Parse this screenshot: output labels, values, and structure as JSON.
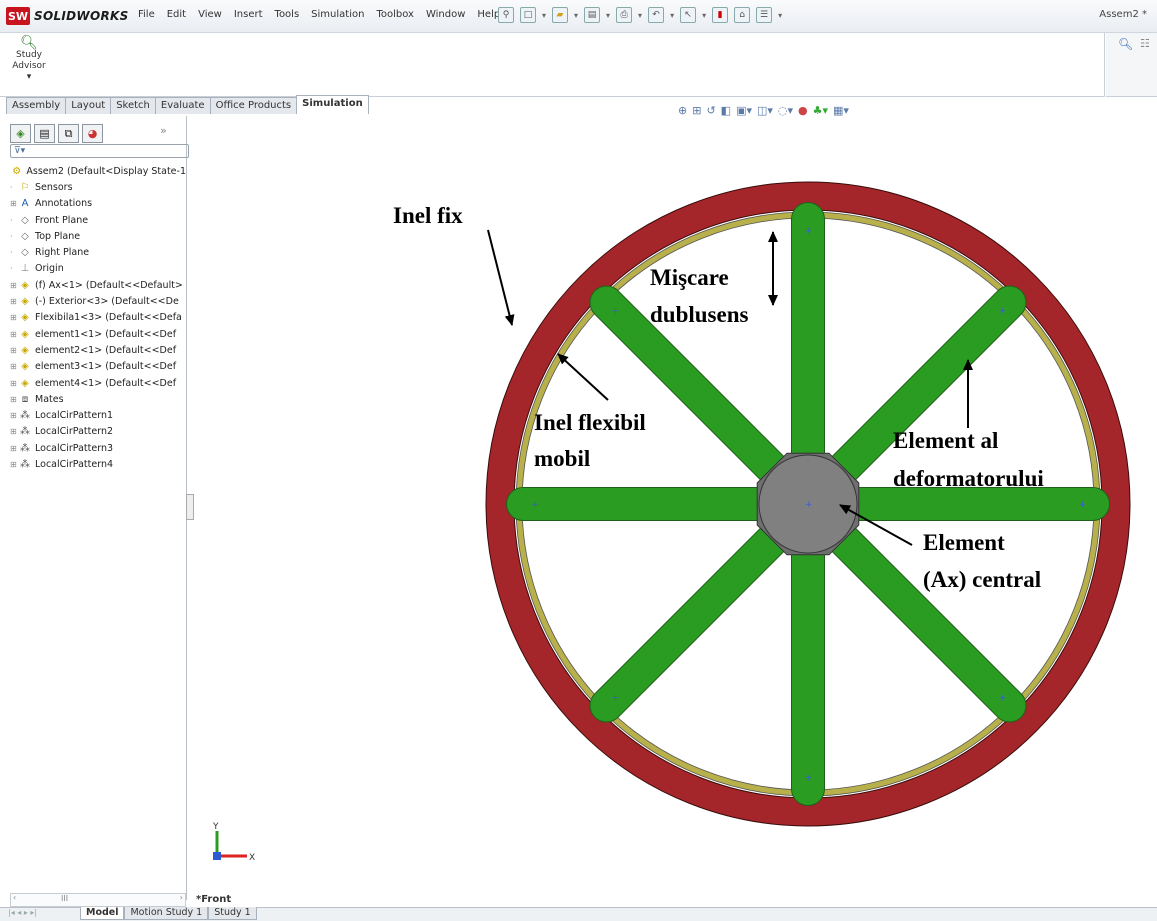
{
  "app": {
    "brand": "SOLIDWORKS",
    "logo_text": "SW",
    "doc_title": "Assem2 *"
  },
  "menu": [
    "File",
    "Edit",
    "View",
    "Insert",
    "Tools",
    "Simulation",
    "Toolbox",
    "Window",
    "Help"
  ],
  "command_manager": {
    "study_advisor_line1": "Study",
    "study_advisor_line2": "Advisor",
    "dropdown": "▾"
  },
  "tabs": [
    {
      "label": "Assembly"
    },
    {
      "label": "Layout"
    },
    {
      "label": "Sketch"
    },
    {
      "label": "Evaluate"
    },
    {
      "label": "Office Products"
    },
    {
      "label": "Simulation",
      "active": true
    }
  ],
  "tree": {
    "root": "Assem2  (Default<Display State-1",
    "items": [
      {
        "icon": "sensor-icon",
        "label": "Sensors"
      },
      {
        "icon": "annotation-icon",
        "label": "Annotations"
      },
      {
        "icon": "plane-icon",
        "label": "Front Plane"
      },
      {
        "icon": "plane-icon",
        "label": "Top Plane"
      },
      {
        "icon": "plane-icon",
        "label": "Right Plane"
      },
      {
        "icon": "origin-icon",
        "label": "Origin"
      },
      {
        "icon": "part-icon",
        "label": "(f) Ax<1> (Default<<Default>"
      },
      {
        "icon": "part-icon",
        "label": "(-) Exterior<3> (Default<<De"
      },
      {
        "icon": "part-icon",
        "label": "Flexibila1<3> (Default<<Defa"
      },
      {
        "icon": "part-icon",
        "label": "element1<1> (Default<<Def"
      },
      {
        "icon": "part-icon",
        "label": "element2<1> (Default<<Def"
      },
      {
        "icon": "part-icon",
        "label": "element3<1> (Default<<Def"
      },
      {
        "icon": "part-icon",
        "label": "element4<1> (Default<<Def"
      },
      {
        "icon": "mates-icon",
        "label": "Mates"
      },
      {
        "icon": "pattern-icon",
        "label": "LocalCirPattern1"
      },
      {
        "icon": "pattern-icon",
        "label": "LocalCirPattern2"
      },
      {
        "icon": "pattern-icon",
        "label": "LocalCirPattern3"
      },
      {
        "icon": "pattern-icon",
        "label": "LocalCirPattern4"
      }
    ]
  },
  "viewport": {
    "view_name": "*Front",
    "triad": {
      "y": "Y",
      "x": "X"
    },
    "colors": {
      "outer_ring": "#a4262a",
      "flex_ring": "#b8b04a",
      "spokes": "#2a9c22",
      "hub": "#808080"
    },
    "labels": {
      "inel_fix": "Inel  fix",
      "miscare_1": "Mişcare",
      "miscare_2": "dublusens",
      "flex_1": "Inel flexibil",
      "flex_2": "mobil",
      "element_1": "Element al",
      "element_2": "deformatorului",
      "central_1": "Element",
      "central_2": "(Ax) central"
    }
  },
  "bottom_tabs": [
    {
      "label": "Model",
      "active": true
    },
    {
      "label": "Motion Study 1"
    },
    {
      "label": "Study 1"
    }
  ],
  "scroll_label": "III"
}
